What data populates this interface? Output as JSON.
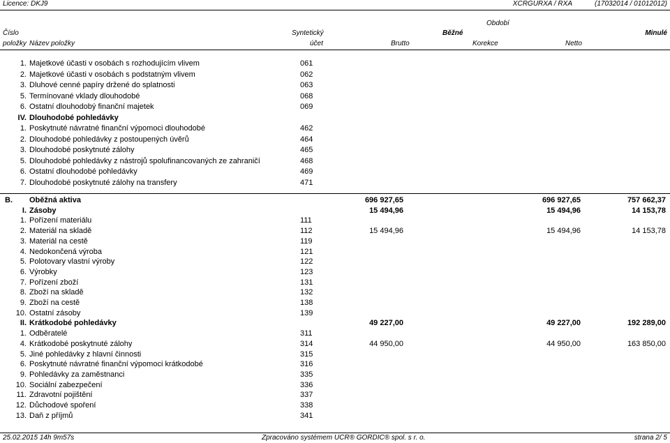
{
  "header": {
    "licence": "Licence: DKJ9",
    "report_id": "XCRGURXA / RXA",
    "report_dates": "(17032014 / 01012012)",
    "col_obdobi": "Období",
    "col_cislo": "Číslo",
    "col_syntheticky": "Syntetický",
    "col_bezne": "Běžné",
    "col_minule": "Minulé",
    "col_polozky": "položky",
    "col_nazev": "Název položky",
    "col_ucet": "účet",
    "col_brutto": "Brutto",
    "col_korekce": "Korekce",
    "col_netto": "Netto"
  },
  "rows": [
    {
      "num": "1.",
      "name": "Majetkové účasti v osobách s rozhodujícím vlivem",
      "acct": "061",
      "bold": false,
      "roman": false
    },
    {
      "num": "2.",
      "name": "Majetkové účasti v osobách s podstatným vlivem",
      "acct": "062",
      "bold": false,
      "roman": false
    },
    {
      "num": "3.",
      "name": "Dluhové cenné papíry držené do splatnosti",
      "acct": "063",
      "bold": false,
      "roman": false
    },
    {
      "num": "5.",
      "name": "Termínované vklady dlouhodobé",
      "acct": "068",
      "bold": false,
      "roman": false
    },
    {
      "num": "6.",
      "name": "Ostatní dlouhodobý finanční majetek",
      "acct": "069",
      "bold": false,
      "roman": false
    },
    {
      "num": "IV.",
      "name": "Dlouhodobé pohledávky",
      "acct": "",
      "bold": true,
      "roman": true
    },
    {
      "num": "1.",
      "name": "Poskytnuté návratné finanční výpomoci dlouhodobé",
      "acct": "462",
      "bold": false,
      "roman": false
    },
    {
      "num": "2.",
      "name": "Dlouhodobé pohledávky z postoupených úvěrů",
      "acct": "464",
      "bold": false,
      "roman": false
    },
    {
      "num": "3.",
      "name": "Dlouhodobé poskytnuté zálohy",
      "acct": "465",
      "bold": false,
      "roman": false
    },
    {
      "num": "5.",
      "name": "Dlouhodobé pohledávky z nástrojů spolufinancovaných ze zahraničí",
      "acct": "468",
      "bold": false,
      "roman": false
    },
    {
      "num": "6.",
      "name": "Ostatní dlouhodobé pohledávky",
      "acct": "469",
      "bold": false,
      "roman": false
    },
    {
      "num": "7.",
      "name": "Dlouhodobé poskytnuté zálohy na transfery",
      "acct": "471",
      "bold": false,
      "roman": false
    }
  ],
  "rows2": [
    {
      "num": "B.",
      "name": "Oběžná aktiva",
      "acct": "",
      "brutto": "696 927,65",
      "netto": "696 927,65",
      "minule": "757 662,37",
      "bold": true,
      "level": 0
    },
    {
      "num": "I.",
      "name": "Zásoby",
      "acct": "",
      "brutto": "15 494,96",
      "netto": "15 494,96",
      "minule": "14 153,78",
      "bold": true,
      "level": 1
    },
    {
      "num": "1.",
      "name": "Pořízení materiálu",
      "acct": "111",
      "brutto": "",
      "netto": "",
      "minule": "",
      "bold": false,
      "level": 2
    },
    {
      "num": "2.",
      "name": "Materiál na skladě",
      "acct": "112",
      "brutto": "15 494,96",
      "netto": "15 494,96",
      "minule": "14 153,78",
      "bold": false,
      "level": 2
    },
    {
      "num": "3.",
      "name": "Materiál na cestě",
      "acct": "119",
      "brutto": "",
      "netto": "",
      "minule": "",
      "bold": false,
      "level": 2
    },
    {
      "num": "4.",
      "name": "Nedokončená výroba",
      "acct": "121",
      "brutto": "",
      "netto": "",
      "minule": "",
      "bold": false,
      "level": 2
    },
    {
      "num": "5.",
      "name": "Polotovary vlastní výroby",
      "acct": "122",
      "brutto": "",
      "netto": "",
      "minule": "",
      "bold": false,
      "level": 2
    },
    {
      "num": "6.",
      "name": "Výrobky",
      "acct": "123",
      "brutto": "",
      "netto": "",
      "minule": "",
      "bold": false,
      "level": 2
    },
    {
      "num": "7.",
      "name": "Pořízení zboží",
      "acct": "131",
      "brutto": "",
      "netto": "",
      "minule": "",
      "bold": false,
      "level": 2
    },
    {
      "num": "8.",
      "name": "Zboží na skladě",
      "acct": "132",
      "brutto": "",
      "netto": "",
      "minule": "",
      "bold": false,
      "level": 2
    },
    {
      "num": "9.",
      "name": "Zboží na cestě",
      "acct": "138",
      "brutto": "",
      "netto": "",
      "minule": "",
      "bold": false,
      "level": 2
    },
    {
      "num": "10.",
      "name": "Ostatní zásoby",
      "acct": "139",
      "brutto": "",
      "netto": "",
      "minule": "",
      "bold": false,
      "level": 2
    },
    {
      "num": "II.",
      "name": "Krátkodobé pohledávky",
      "acct": "",
      "brutto": "49 227,00",
      "netto": "49 227,00",
      "minule": "192 289,00",
      "bold": true,
      "level": 1
    },
    {
      "num": "1.",
      "name": "Odběratelé",
      "acct": "311",
      "brutto": "",
      "netto": "",
      "minule": "",
      "bold": false,
      "level": 2
    },
    {
      "num": "4.",
      "name": "Krátkodobé poskytnuté zálohy",
      "acct": "314",
      "brutto": "44 950,00",
      "netto": "44 950,00",
      "minule": "163 850,00",
      "bold": false,
      "level": 2
    },
    {
      "num": "5.",
      "name": "Jiné pohledávky z hlavní činnosti",
      "acct": "315",
      "brutto": "",
      "netto": "",
      "minule": "",
      "bold": false,
      "level": 2
    },
    {
      "num": "6.",
      "name": "Poskytnuté návratné finanční výpomoci krátkodobé",
      "acct": "316",
      "brutto": "",
      "netto": "",
      "minule": "",
      "bold": false,
      "level": 2
    },
    {
      "num": "9.",
      "name": "Pohledávky za zaměstnanci",
      "acct": "335",
      "brutto": "",
      "netto": "",
      "minule": "",
      "bold": false,
      "level": 2
    },
    {
      "num": "10.",
      "name": "Sociální zabezpečení",
      "acct": "336",
      "brutto": "",
      "netto": "",
      "minule": "",
      "bold": false,
      "level": 2
    },
    {
      "num": "11.",
      "name": "Zdravotní pojištění",
      "acct": "337",
      "brutto": "",
      "netto": "",
      "minule": "",
      "bold": false,
      "level": 2
    },
    {
      "num": "12.",
      "name": "Důchodové spoření",
      "acct": "338",
      "brutto": "",
      "netto": "",
      "minule": "",
      "bold": false,
      "level": 2
    },
    {
      "num": "13.",
      "name": "Daň z příjmů",
      "acct": "341",
      "brutto": "",
      "netto": "",
      "minule": "",
      "bold": false,
      "level": 2
    }
  ],
  "footer": {
    "timestamp": "25.02.2015 14h 9m57s",
    "processed": "Zpracováno systémem  UCR® GORDIC® spol. s  r. o.",
    "page": "strana  2/ 5"
  }
}
